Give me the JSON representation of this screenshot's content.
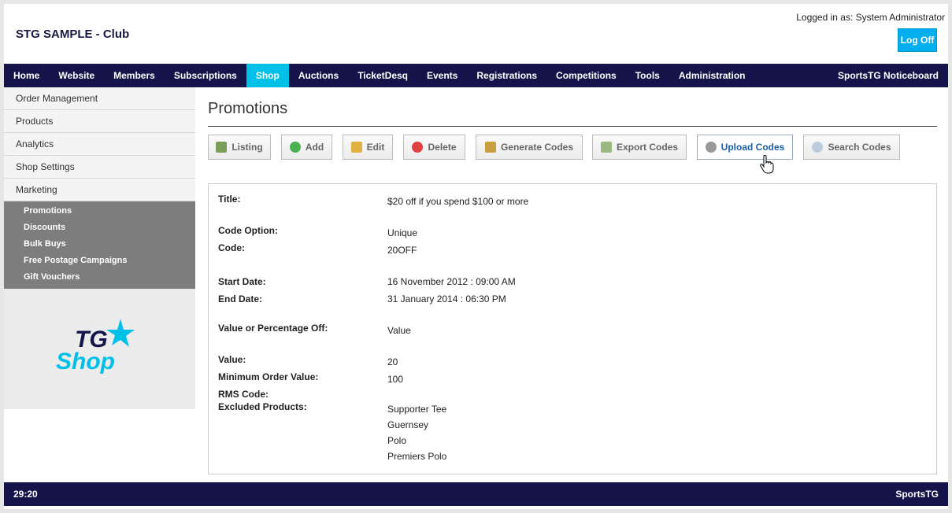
{
  "header": {
    "club_title": "STG SAMPLE - Club",
    "logged_in": "Logged in as: System Administrator",
    "logoff_label": "Log Off"
  },
  "nav": {
    "items": [
      "Home",
      "Website",
      "Members",
      "Subscriptions",
      "Shop",
      "Auctions",
      "TicketDesq",
      "Events",
      "Registrations",
      "Competitions",
      "Tools",
      "Administration"
    ],
    "active": "Shop",
    "right": "SportsTG Noticeboard"
  },
  "sidebar": {
    "items": [
      "Order Management",
      "Products",
      "Analytics",
      "Shop Settings",
      "Marketing"
    ],
    "sub_items": [
      "Promotions",
      "Discounts",
      "Bulk Buys",
      "Free Postage Campaigns",
      "Gift Vouchers"
    ],
    "logo_top": "TG",
    "logo_bottom": "Shop"
  },
  "main": {
    "title": "Promotions",
    "buttons": [
      "Listing",
      "Add",
      "Edit",
      "Delete",
      "Generate Codes",
      "Export Codes",
      "Upload Codes",
      "Search Codes"
    ]
  },
  "details": {
    "title_label": "Title:",
    "title_value": "$20 off if you spend $100 or more",
    "code_option_label": "Code Option:",
    "code_option_value": "Unique",
    "code_label": "Code:",
    "code_value": "20OFF",
    "start_label": "Start Date:",
    "start_value": "16 November 2012 : 09:00 AM",
    "end_label": "End Date:",
    "end_value": "31 January 2014 : 06:30 PM",
    "vp_label": "Value or Percentage Off:",
    "vp_value": "Value",
    "value_label": "Value:",
    "value_value": "20",
    "min_label": "Minimum Order Value:",
    "min_value": "100",
    "rms_label": "RMS Code:",
    "excluded_label": "Excluded Products:",
    "excluded": [
      "Supporter Tee",
      "Guernsey",
      "Polo",
      "Premiers Polo"
    ]
  },
  "footer": {
    "left": "29:20",
    "right": "SportsTG"
  },
  "colors": {
    "nav_bg": "#14144a",
    "accent": "#00c0e8",
    "logoff_bg": "#00aeef"
  }
}
